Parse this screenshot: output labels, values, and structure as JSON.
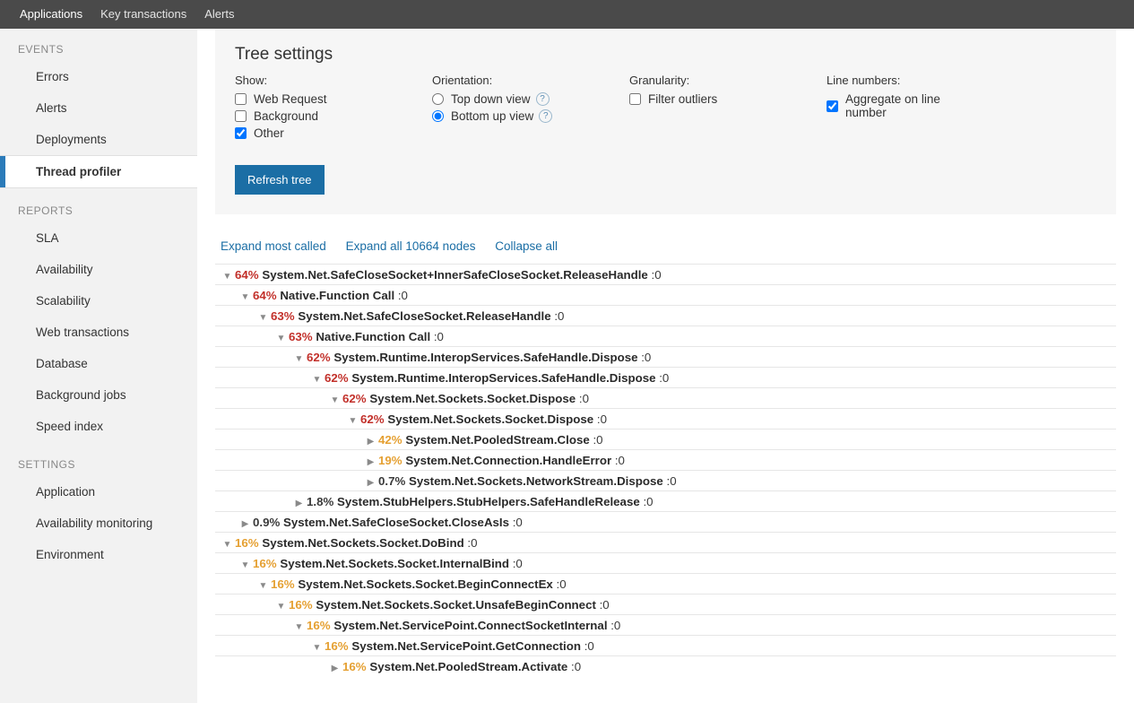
{
  "topnav": {
    "items": [
      {
        "label": "Applications",
        "active": true
      },
      {
        "label": "Key transactions",
        "active": false
      },
      {
        "label": "Alerts",
        "active": false
      }
    ]
  },
  "sidebar": {
    "sections": [
      {
        "title": "EVENTS",
        "items": [
          {
            "label": "Errors",
            "selected": false
          },
          {
            "label": "Alerts",
            "selected": false
          },
          {
            "label": "Deployments",
            "selected": false
          },
          {
            "label": "Thread profiler",
            "selected": true
          }
        ]
      },
      {
        "title": "REPORTS",
        "items": [
          {
            "label": "SLA"
          },
          {
            "label": "Availability"
          },
          {
            "label": "Scalability"
          },
          {
            "label": "Web transactions"
          },
          {
            "label": "Database"
          },
          {
            "label": "Background jobs"
          },
          {
            "label": "Speed index"
          }
        ]
      },
      {
        "title": "SETTINGS",
        "items": [
          {
            "label": "Application"
          },
          {
            "label": "Availability monitoring"
          },
          {
            "label": "Environment"
          }
        ]
      }
    ]
  },
  "tree_settings": {
    "title": "Tree settings",
    "show": {
      "label": "Show:",
      "options": [
        {
          "label": "Web Request",
          "checked": false
        },
        {
          "label": "Background",
          "checked": false
        },
        {
          "label": "Other",
          "checked": true
        }
      ]
    },
    "orientation": {
      "label": "Orientation:",
      "options": [
        {
          "label": "Top down view",
          "checked": false,
          "help": true
        },
        {
          "label": "Bottom up view",
          "checked": true,
          "help": true
        }
      ]
    },
    "granularity": {
      "label": "Granularity:",
      "options": [
        {
          "label": "Filter outliers",
          "checked": false
        }
      ]
    },
    "line_numbers": {
      "label": "Line numbers:",
      "options": [
        {
          "label": "Aggregate on line number",
          "checked": true
        }
      ]
    },
    "refresh_button": "Refresh tree"
  },
  "tree_actions": {
    "expand_most_called": "Expand most called",
    "expand_all": "Expand all 10664 nodes",
    "collapse_all": "Collapse all"
  },
  "tree": [
    {
      "indent": 0,
      "expanded": true,
      "pct": "64%",
      "pctClass": "pct-red",
      "name": "System.Net.SafeCloseSocket+InnerSafeCloseSocket.ReleaseHandle",
      "suffix": ":0"
    },
    {
      "indent": 1,
      "expanded": true,
      "pct": "64%",
      "pctClass": "pct-red",
      "name": "Native.Function Call",
      "suffix": ":0"
    },
    {
      "indent": 2,
      "expanded": true,
      "pct": "63%",
      "pctClass": "pct-red",
      "name": "System.Net.SafeCloseSocket.ReleaseHandle",
      "suffix": ":0"
    },
    {
      "indent": 3,
      "expanded": true,
      "pct": "63%",
      "pctClass": "pct-red",
      "name": "Native.Function Call",
      "suffix": ":0"
    },
    {
      "indent": 4,
      "expanded": true,
      "pct": "62%",
      "pctClass": "pct-red",
      "name": "System.Runtime.InteropServices.SafeHandle.Dispose",
      "suffix": ":0"
    },
    {
      "indent": 5,
      "expanded": true,
      "pct": "62%",
      "pctClass": "pct-red",
      "name": "System.Runtime.InteropServices.SafeHandle.Dispose",
      "suffix": ":0"
    },
    {
      "indent": 6,
      "expanded": true,
      "pct": "62%",
      "pctClass": "pct-red",
      "name": "System.Net.Sockets.Socket.Dispose",
      "suffix": ":0"
    },
    {
      "indent": 7,
      "expanded": true,
      "pct": "62%",
      "pctClass": "pct-red",
      "name": "System.Net.Sockets.Socket.Dispose",
      "suffix": ":0"
    },
    {
      "indent": 8,
      "expanded": false,
      "pct": "42%",
      "pctClass": "pct-orange",
      "name": "System.Net.PooledStream.Close",
      "suffix": ":0"
    },
    {
      "indent": 8,
      "expanded": false,
      "pct": "19%",
      "pctClass": "pct-orange",
      "name": "System.Net.Connection.HandleError",
      "suffix": ":0"
    },
    {
      "indent": 8,
      "expanded": false,
      "pct": "0.7%",
      "pctClass": "pct-gray",
      "name": "System.Net.Sockets.NetworkStream.Dispose",
      "suffix": ":0"
    },
    {
      "indent": 4,
      "expanded": false,
      "pct": "1.8%",
      "pctClass": "pct-gray",
      "name": "System.StubHelpers.StubHelpers.SafeHandleRelease",
      "suffix": ":0"
    },
    {
      "indent": 1,
      "expanded": false,
      "pct": "0.9%",
      "pctClass": "pct-gray",
      "name": "System.Net.SafeCloseSocket.CloseAsIs",
      "suffix": ":0"
    },
    {
      "indent": 0,
      "expanded": true,
      "pct": "16%",
      "pctClass": "pct-orange",
      "name": "System.Net.Sockets.Socket.DoBind",
      "suffix": ":0"
    },
    {
      "indent": 1,
      "expanded": true,
      "pct": "16%",
      "pctClass": "pct-orange",
      "name": "System.Net.Sockets.Socket.InternalBind",
      "suffix": ":0"
    },
    {
      "indent": 2,
      "expanded": true,
      "pct": "16%",
      "pctClass": "pct-orange",
      "name": "System.Net.Sockets.Socket.BeginConnectEx",
      "suffix": ":0"
    },
    {
      "indent": 3,
      "expanded": true,
      "pct": "16%",
      "pctClass": "pct-orange",
      "name": "System.Net.Sockets.Socket.UnsafeBeginConnect",
      "suffix": ":0"
    },
    {
      "indent": 4,
      "expanded": true,
      "pct": "16%",
      "pctClass": "pct-orange",
      "name": "System.Net.ServicePoint.ConnectSocketInternal",
      "suffix": ":0"
    },
    {
      "indent": 5,
      "expanded": true,
      "pct": "16%",
      "pctClass": "pct-orange",
      "name": "System.Net.ServicePoint.GetConnection",
      "suffix": ":0"
    },
    {
      "indent": 6,
      "expanded": false,
      "pct": "16%",
      "pctClass": "pct-orange",
      "name": "System.Net.PooledStream.Activate",
      "suffix": ":0"
    }
  ]
}
